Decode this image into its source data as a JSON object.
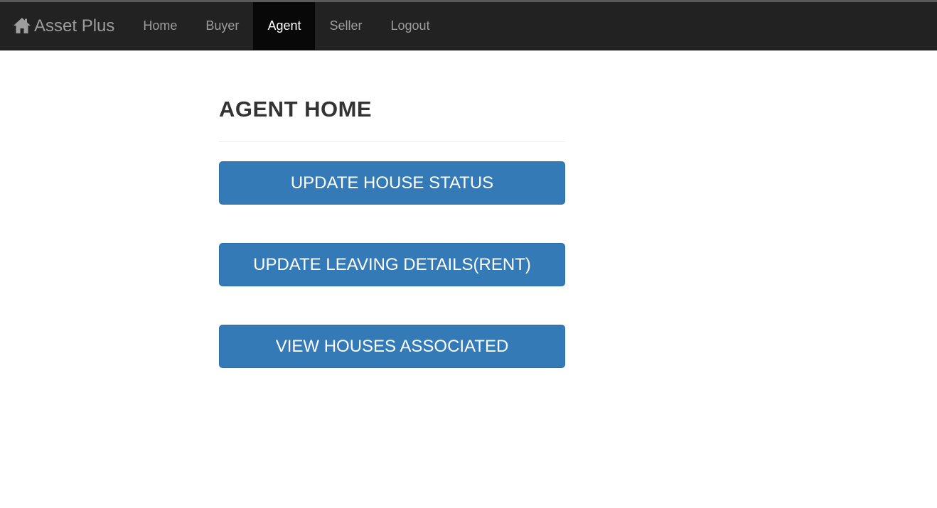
{
  "navbar": {
    "brand": "Asset Plus",
    "brand_icon": "home-icon",
    "items": [
      {
        "label": "Home",
        "active": false
      },
      {
        "label": "Buyer",
        "active": false
      },
      {
        "label": "Agent",
        "active": true
      },
      {
        "label": "Seller",
        "active": false
      },
      {
        "label": "Logout",
        "active": false
      }
    ]
  },
  "main": {
    "title": "AGENT HOME",
    "buttons": [
      {
        "label": "UPDATE HOUSE STATUS"
      },
      {
        "label": "UPDATE LEAVING DETAILS(RENT)"
      },
      {
        "label": "VIEW HOUSES ASSOCIATED"
      }
    ]
  },
  "colors": {
    "navbar_bg": "#222222",
    "nav_active_bg": "#080808",
    "nav_text": "#9d9d9d",
    "button_primary": "#337ab7",
    "title_text": "#333333"
  }
}
